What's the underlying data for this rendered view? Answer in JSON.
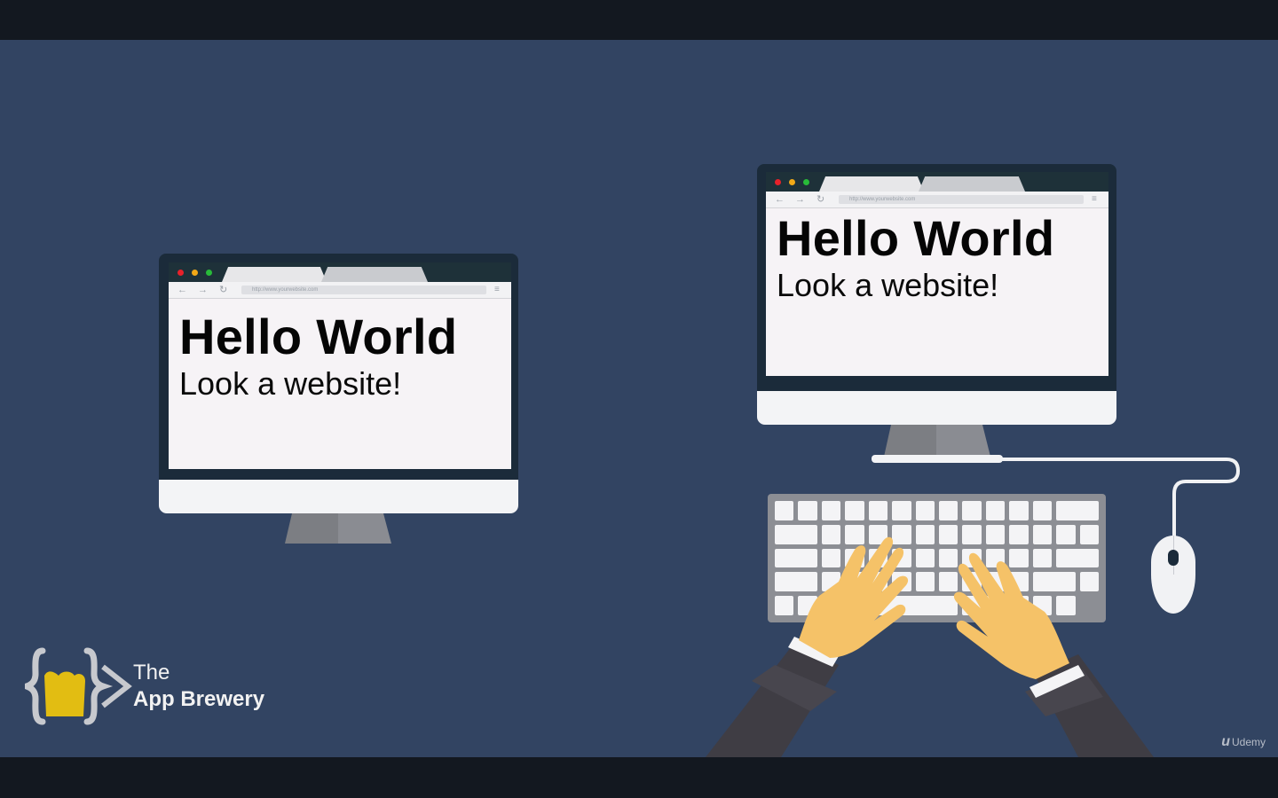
{
  "scene": {
    "background_color": "#324462",
    "letterbox_color": "#131820"
  },
  "monitor_left": {
    "url": "http://www.yourwebsite.com",
    "heading": "Hello World",
    "paragraph": "Look a website!"
  },
  "monitor_right": {
    "url": "http://www.yourwebsite.com",
    "heading": "Hello World",
    "paragraph": "Look a website!"
  },
  "browser_icons": {
    "back": "back-arrow-icon",
    "forward": "forward-arrow-icon",
    "reload": "reload-icon",
    "page": "page-icon",
    "menu": "hamburger-menu-icon"
  },
  "colors": {
    "window_close": "#e8212a",
    "window_minimize": "#f2a917",
    "window_maximize": "#28bb39",
    "logo_accent": "#e2bd12",
    "skin": "#f5c268",
    "sleeve": "#3f3d44"
  },
  "logo": {
    "line1": "The",
    "line2": "App Brewery"
  },
  "watermark": {
    "glyph": "u",
    "text": "Udemy"
  }
}
